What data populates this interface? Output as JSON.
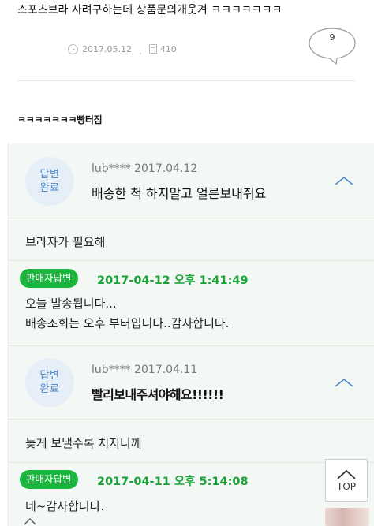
{
  "post": {
    "title": "스포츠브라 사려구하는데 상품문의개웃겨 ㅋㅋㅋㅋㅋㅋㅋ",
    "date": "2017.05.12",
    "views": "410",
    "comment_count": "9"
  },
  "sub_title": "ㅋㅋㅋㅋㅋㅋㅋ빵터짐",
  "qa": [
    {
      "badge_line1": "답변",
      "badge_line2": "완료",
      "author_date": "lub**** 2017.04.12",
      "question": "배송한 척 하지말고 얼른보내줘요",
      "request": "브라자가 필요해",
      "seller_label": "판매자답변",
      "reply_date": "2017-04-12 오후 1:41:49",
      "reply_lines": [
        "오늘 발송됩니다...",
        "배송조회는 오후 부터입니다..감사합니다."
      ]
    },
    {
      "badge_line1": "답변",
      "badge_line2": "완료",
      "author_date": "lub**** 2017.04.11",
      "question": "빨리보내주셔야해요!!!!!!",
      "request": "늦게 보낼수록 처지니께",
      "seller_label": "판매자답변",
      "reply_date": "2017-04-11 오후 5:14:08",
      "reply_lines": [
        "네~감사합니다."
      ]
    }
  ],
  "top_button": {
    "label": "TOP"
  },
  "colors": {
    "accent_green": "#19b53c",
    "badge_blue": "#4a86c6",
    "panel_bg": "#f4f8f4"
  }
}
